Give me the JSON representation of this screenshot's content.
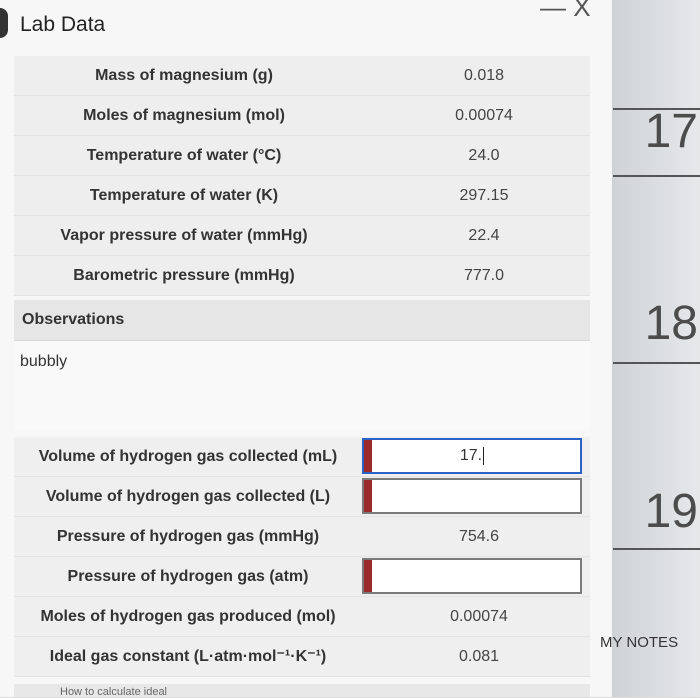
{
  "window": {
    "title": "Lab Data",
    "controls": "— X"
  },
  "lab_rows": [
    {
      "label": "Mass of magnesium (g)",
      "value": "0.018"
    },
    {
      "label": "Moles of magnesium (mol)",
      "value": "0.00074"
    },
    {
      "label": "Temperature of water (°C)",
      "value": "24.0"
    },
    {
      "label": "Temperature of water (K)",
      "value": "297.15"
    },
    {
      "label": "Vapor pressure of water (mmHg)",
      "value": "22.4"
    },
    {
      "label": "Barometric pressure (mmHg)",
      "value": "777.0"
    }
  ],
  "observations": {
    "header": "Observations",
    "text": "bubbly"
  },
  "gas_rows": [
    {
      "label": "Volume of hydrogen gas collected (mL)",
      "input_value": "17."
    },
    {
      "label": "Volume of hydrogen gas collected (L)",
      "input_value": ""
    },
    {
      "label": "Pressure of hydrogen gas (mmHg)",
      "value": "754.6"
    },
    {
      "label": "Pressure of hydrogen gas (atm)",
      "input_value": ""
    },
    {
      "label": "Moles of hydrogen gas produced (mol)",
      "value": "0.00074"
    },
    {
      "label": "Ideal gas constant (L·atm·mol⁻¹·K⁻¹)",
      "value": "0.081"
    }
  ],
  "footer_text": "How to calculate ideal",
  "background": {
    "numbers": [
      "17",
      "18",
      "19"
    ]
  },
  "notes": {
    "label": "MY NOTES"
  },
  "colors": {
    "input_flag": "#9c2a2a",
    "active_border": "#2a62c8"
  }
}
